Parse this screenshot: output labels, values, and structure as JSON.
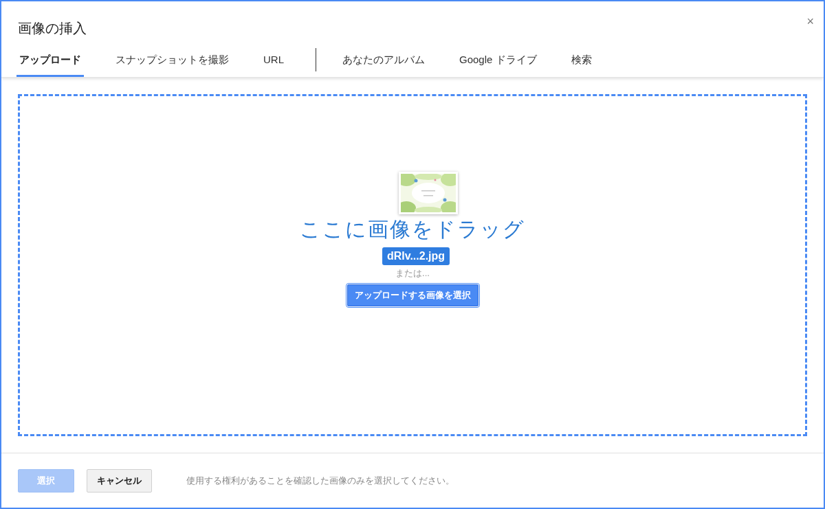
{
  "dialog": {
    "title": "画像の挿入",
    "close": "×"
  },
  "tabs": [
    {
      "label": "アップロード",
      "selected": true,
      "divider_after": false
    },
    {
      "label": "スナップショットを撮影",
      "selected": false,
      "divider_after": false
    },
    {
      "label": "URL",
      "selected": false,
      "divider_after": true
    },
    {
      "label": "あなたのアルバム",
      "selected": false,
      "divider_after": false
    },
    {
      "label": "Google ドライブ",
      "selected": false,
      "divider_after": false
    },
    {
      "label": "検索",
      "selected": false,
      "divider_after": false
    }
  ],
  "drop_zone": {
    "heading": "ここに画像をドラッグ",
    "or_text": "または...",
    "upload_button": "アップロードする画像を選択",
    "drag_ghost": {
      "kind": "picture",
      "filename": "dRIv...2.jpg"
    }
  },
  "footer": {
    "buttons": [
      {
        "label": "選択",
        "disabled": true
      },
      {
        "label": "キャンセル",
        "disabled": false
      }
    ],
    "notice": "使用する権利があることを確認した画像のみを選択してください。"
  }
}
